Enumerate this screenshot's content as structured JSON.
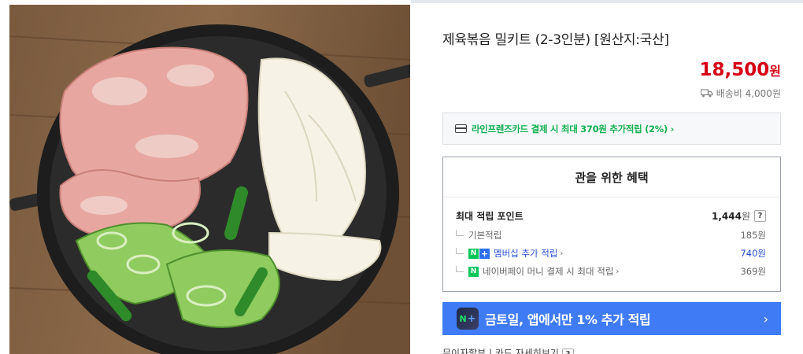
{
  "product": {
    "title": "제육볶음 밀키트 (2-3인분) [원산지:국산]",
    "price": "18,500",
    "price_unit": "원",
    "shipping": "배송비 4,000원",
    "image_alt": "제육볶음 밀키트"
  },
  "card_banner": {
    "text": "라인프렌즈카드 결제 시 최대 370원 추가적립 (2%) ›"
  },
  "benefit": {
    "title": "관을 위한 혜택",
    "main_label": "최대 적립 포인트",
    "main_value": "1,444",
    "main_unit": "원",
    "help": "?",
    "rows": [
      {
        "label": "기본적립",
        "value": "185원"
      },
      {
        "label": "멤버십 추가 적립",
        "value": "740원",
        "badge1": "N",
        "badge2": "+",
        "chevron": "›"
      },
      {
        "label": "네이버페이 머니 결제 시 최대 적립",
        "value": "369원",
        "badge1": "N",
        "chevron": "›"
      }
    ]
  },
  "app_banner": {
    "icon_n": "N",
    "icon_plus": "+",
    "text": "금토일, 앱에서만 1% 추가 적립",
    "arrow": "›"
  },
  "bottom_cutoff": {
    "text": "무이자할부 | 카드 자세히보기",
    "help": "?"
  },
  "colors": {
    "price_red": "#d60016",
    "naver_green": "#12b050",
    "app_blue": "#3f7bf4",
    "membership_blue": "#2a4fd6"
  }
}
